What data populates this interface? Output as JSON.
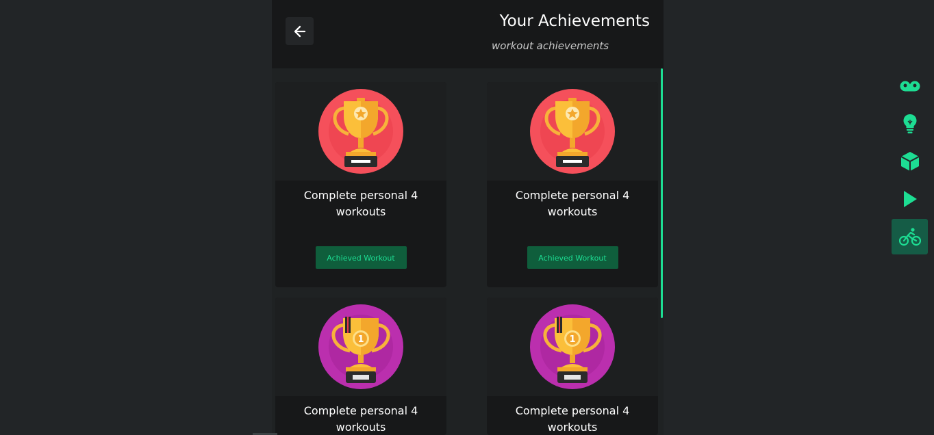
{
  "header": {
    "title": "Your Achievements",
    "subtitle": "workout achievements",
    "back_icon": "arrow-left-icon"
  },
  "achievements": [
    {
      "title": "Complete personal 4 workouts",
      "button": "Achieved Workout",
      "icon": "trophy-star-icon",
      "badge_color": "#f5505b"
    },
    {
      "title": "Complete personal 4 workouts",
      "button": "Achieved Workout",
      "icon": "trophy-star-icon",
      "badge_color": "#f5505b"
    },
    {
      "title": "Complete personal 4 workouts",
      "icon": "trophy-first-place-icon",
      "badge_color": "#bb2fae"
    },
    {
      "title": "Complete personal 4 workouts",
      "icon": "trophy-first-place-icon",
      "badge_color": "#bb2fae"
    }
  ],
  "sidebar": {
    "items": [
      {
        "icon": "tape-icon",
        "active": false
      },
      {
        "icon": "lightbulb-icon",
        "active": false
      },
      {
        "icon": "cube-icon",
        "active": false
      },
      {
        "icon": "play-icon",
        "active": false
      },
      {
        "icon": "bicycle-icon",
        "active": true
      }
    ]
  },
  "colors": {
    "accent": "#1ddd93",
    "button_bg": "#0f5e3c",
    "active_sidebar_bg": "#155c46",
    "background": "#222527",
    "card_bg": "#171819"
  }
}
